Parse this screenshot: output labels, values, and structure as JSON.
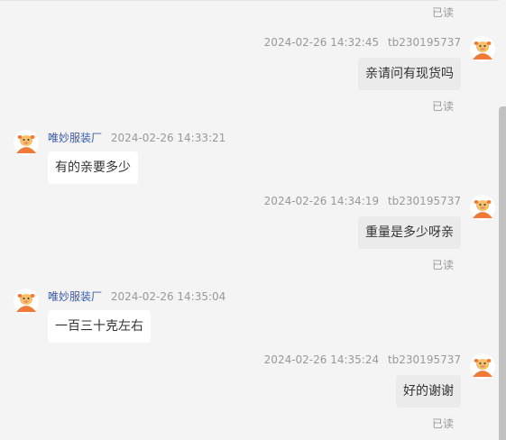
{
  "read_label": "已读",
  "messages": [
    {
      "side": "out",
      "time": "2024-02-26 14:32:45",
      "user": "tb230195737",
      "text": "亲请问有现货吗",
      "read": "已读"
    },
    {
      "side": "in",
      "user": "唯妙服装厂",
      "time": "2024-02-26 14:33:21",
      "text": "有的亲要多少"
    },
    {
      "side": "out",
      "time": "2024-02-26 14:34:19",
      "user": "tb230195737",
      "text": "重量是多少呀亲",
      "read": "已读"
    },
    {
      "side": "in",
      "user": "唯妙服装厂",
      "time": "2024-02-26 14:35:04",
      "text": "一百三十克左右"
    },
    {
      "side": "out",
      "time": "2024-02-26 14:35:24",
      "user": "tb230195737",
      "text": "好的谢谢",
      "read": "已读"
    }
  ],
  "colors": {
    "background": "#f4f4f4",
    "bubble_in": "#ffffff",
    "bubble_out": "#ebebeb",
    "shop_name": "#3c5aa6",
    "muted": "#999999"
  },
  "icons": {
    "avatar": "cartoon-animal-avatar-icon"
  }
}
